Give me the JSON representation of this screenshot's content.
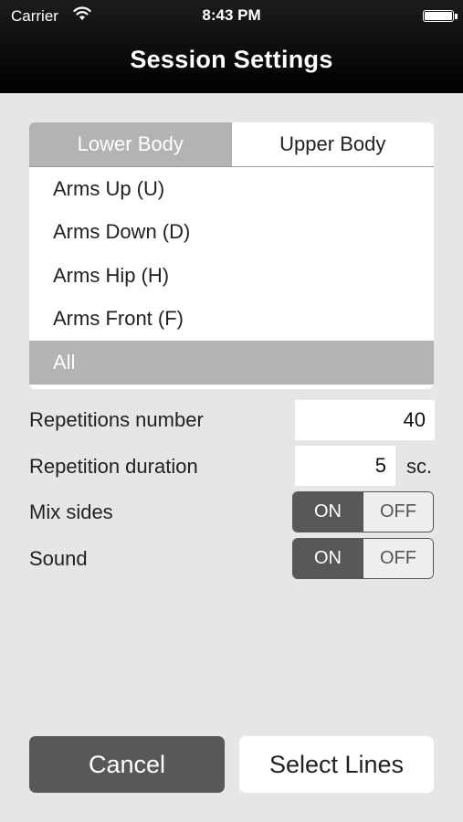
{
  "status": {
    "carrier": "Carrier",
    "time": "8:43 PM"
  },
  "nav": {
    "title": "Session Settings"
  },
  "tabs": [
    {
      "label": "Lower Body",
      "active": true
    },
    {
      "label": "Upper Body",
      "active": false
    }
  ],
  "options": [
    {
      "label": "Arms Up (U)"
    },
    {
      "label": "Arms Down (D)"
    },
    {
      "label": "Arms Hip (H)"
    },
    {
      "label": "Arms Front (F)"
    },
    {
      "label": "All",
      "selected": true
    }
  ],
  "settings": {
    "repetitions": {
      "label": "Repetitions number",
      "value": "40"
    },
    "duration": {
      "label": "Repetition duration",
      "value": "5",
      "unit": "sc."
    },
    "mix_sides": {
      "label": "Mix sides",
      "on": "ON",
      "off": "OFF",
      "state": "on"
    },
    "sound": {
      "label": "Sound",
      "on": "ON",
      "off": "OFF",
      "state": "on"
    }
  },
  "buttons": {
    "cancel": "Cancel",
    "select_lines": "Select Lines"
  },
  "colors": {
    "background": "#e6e6e6",
    "selected": "#b3b3b3",
    "dark": "#585858"
  }
}
